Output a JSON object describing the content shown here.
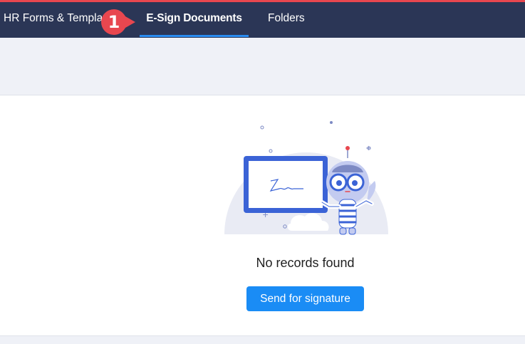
{
  "nav": {
    "tabs": [
      {
        "label": "HR Forms & Templates",
        "active": false
      },
      {
        "label": "E-Sign Documents",
        "active": true
      },
      {
        "label": "Folders",
        "active": false
      }
    ]
  },
  "annotation": {
    "step_number": "1"
  },
  "empty_state": {
    "message": "No records found",
    "illustration": "signature-board-robot-icon",
    "action_label": "Send for signature"
  },
  "colors": {
    "navbar": "#2b3656",
    "accent": "#1a8cf5",
    "top_line": "#e8474f",
    "badge": "#e8474f",
    "subbar": "#eff1f7"
  }
}
